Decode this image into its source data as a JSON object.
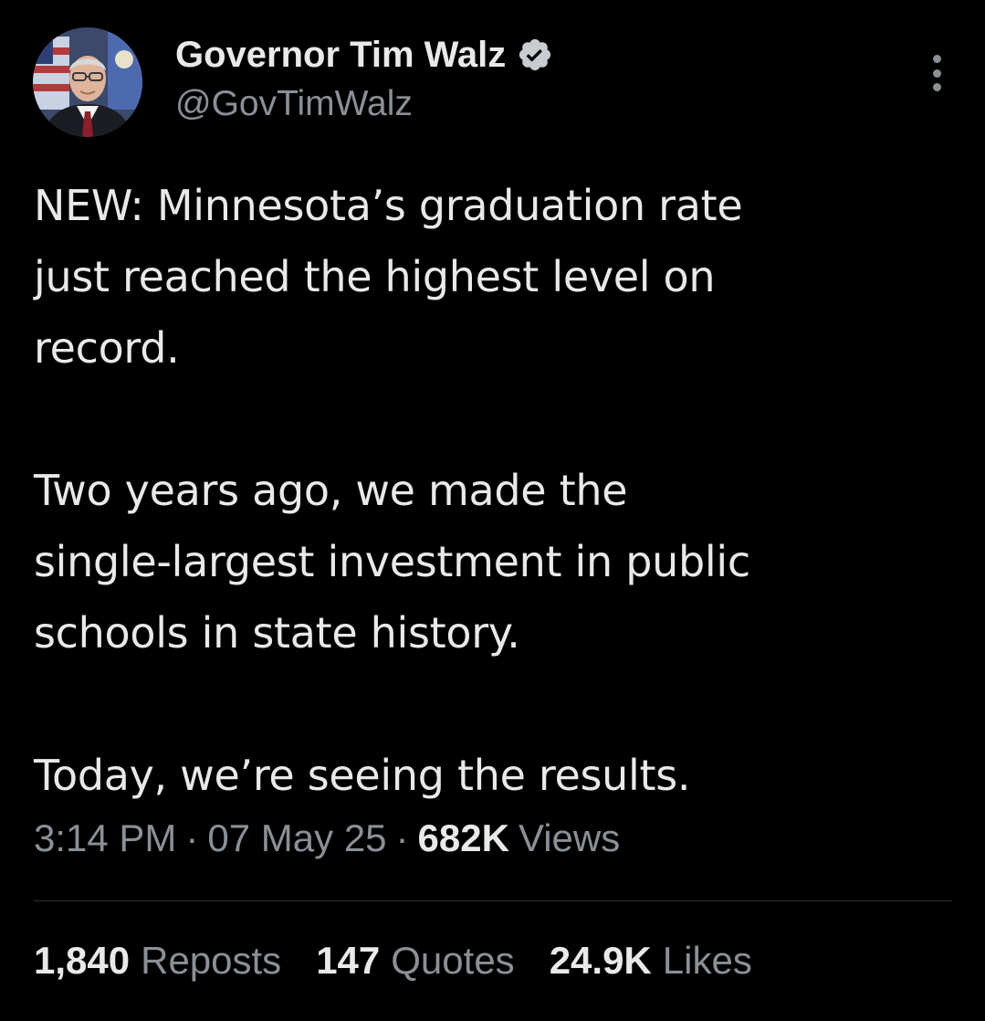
{
  "author": {
    "display_name": "Governor Tim Walz",
    "handle": "@GovTimWalz",
    "verified_icon": "verified-badge-icon",
    "avatar_icon": "profile-photo"
  },
  "more_icon": "more-options-icon",
  "tweet": {
    "paragraphs": [
      "NEW: Minnesota’s graduation rate\njust reached the highest level on\nrecord.",
      "Two years ago, we made the\nsingle-largest investment in public\nschools in state history.",
      "Today, we’re seeing the results."
    ]
  },
  "meta": {
    "time": "3:14 PM",
    "separator": "·",
    "date": "07 May 25",
    "views_count": "682K",
    "views_label": "Views"
  },
  "stats": {
    "reposts_count": "1,840",
    "reposts_label": "Reposts",
    "quotes_count": "147",
    "quotes_label": "Quotes",
    "likes_count": "24.9K",
    "likes_label": "Likes"
  },
  "colors": {
    "background": "#000000",
    "primary_text": "#e7e9ea",
    "secondary_text": "#8b9096",
    "divider": "#2f3336",
    "verified": "#c9ccd1"
  }
}
